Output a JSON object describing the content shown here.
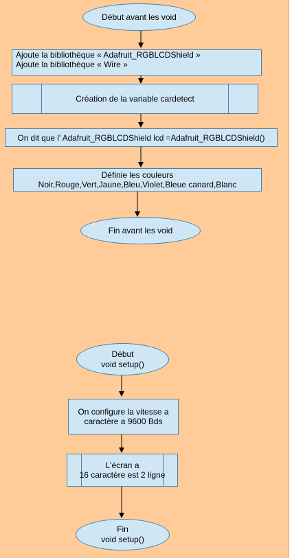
{
  "nodes": {
    "start_avant": "Début avant les void",
    "libs": [
      "Ajoute la bibliothèque « Adafruit_RGBLCDShield  »",
      "Ajoute la bibliothèque « Wire »"
    ],
    "cardetect": "Création de la variable cardetect",
    "lcd": "On dit que l' Adafruit_RGBLCDShield lcd =Adafruit_RGBLCDShield()",
    "colors": [
      "Définie les couleurs",
      "Noir,Rouge,Vert,Jaune,Bleu,Violet,Bleue canard,Blanc"
    ],
    "end_avant": "Fin avant les void",
    "start_setup": [
      "Début",
      "void setup()"
    ],
    "speed": [
      "On configure la vitesse a",
      "caractère a 9600 Bds"
    ],
    "screen": [
      "L'écran a",
      "16 caractère est 2 ligne"
    ],
    "end_setup": [
      "Fin",
      "void setup()"
    ]
  },
  "colors": {
    "background": "#ffcc99",
    "shape_fill": "#cfe7f5",
    "shape_border": "#4a7ea8"
  }
}
